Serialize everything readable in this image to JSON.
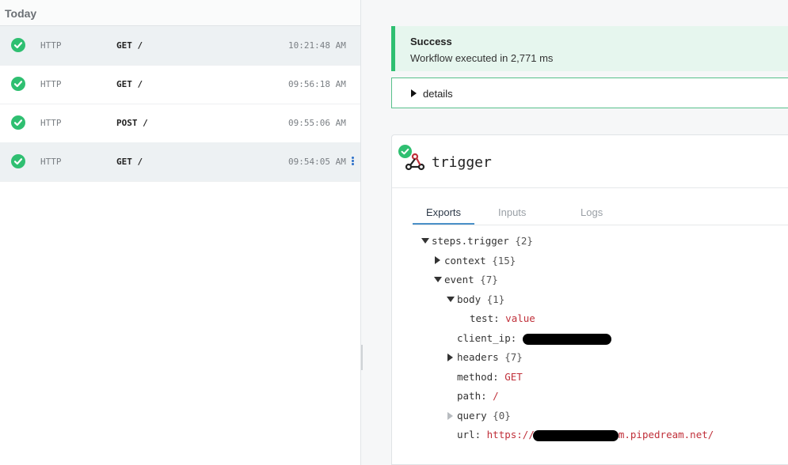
{
  "sidebar": {
    "section_label": "Today",
    "events": [
      {
        "source": "HTTP",
        "request": "GET /",
        "time": "10:21:48 AM",
        "selected": true
      },
      {
        "source": "HTTP",
        "request": "GET /",
        "time": "09:56:18 AM",
        "selected": false
      },
      {
        "source": "HTTP",
        "request": "POST /",
        "time": "09:55:06 AM",
        "selected": false
      },
      {
        "source": "HTTP",
        "request": "GET /",
        "time": "09:54:05 AM",
        "selected": true
      }
    ]
  },
  "status": {
    "title": "Success",
    "message": "Workflow executed in 2,771 ms"
  },
  "details": {
    "label": "details"
  },
  "step": {
    "title": "trigger",
    "tabs": [
      "Exports",
      "Inputs",
      "Logs"
    ],
    "active_tab": "Exports",
    "tree": {
      "root": {
        "key": "steps.trigger",
        "count": "{2}"
      },
      "context": {
        "key": "context",
        "count": "{15}"
      },
      "event": {
        "key": "event",
        "count": "{7}"
      },
      "body": {
        "key": "body",
        "count": "{1}"
      },
      "test": {
        "key": "test:",
        "value": "value"
      },
      "client_ip": {
        "key": "client_ip:"
      },
      "headers": {
        "key": "headers",
        "count": "{7}"
      },
      "method": {
        "key": "method:",
        "value": "GET"
      },
      "path": {
        "key": "path:",
        "value": "/"
      },
      "query": {
        "key": "query",
        "count": "{0}"
      },
      "url": {
        "key": "url:",
        "value_prefix": "https://",
        "value_suffix": "m.pipedream.net/"
      }
    }
  },
  "colors": {
    "success": "#2fbf71",
    "accent": "#4a90c8",
    "value": "#c0303a"
  },
  "icons": [
    "check-circle-icon",
    "more-vertical-icon",
    "caret-right-icon",
    "caret-down-icon",
    "webhook-icon"
  ]
}
